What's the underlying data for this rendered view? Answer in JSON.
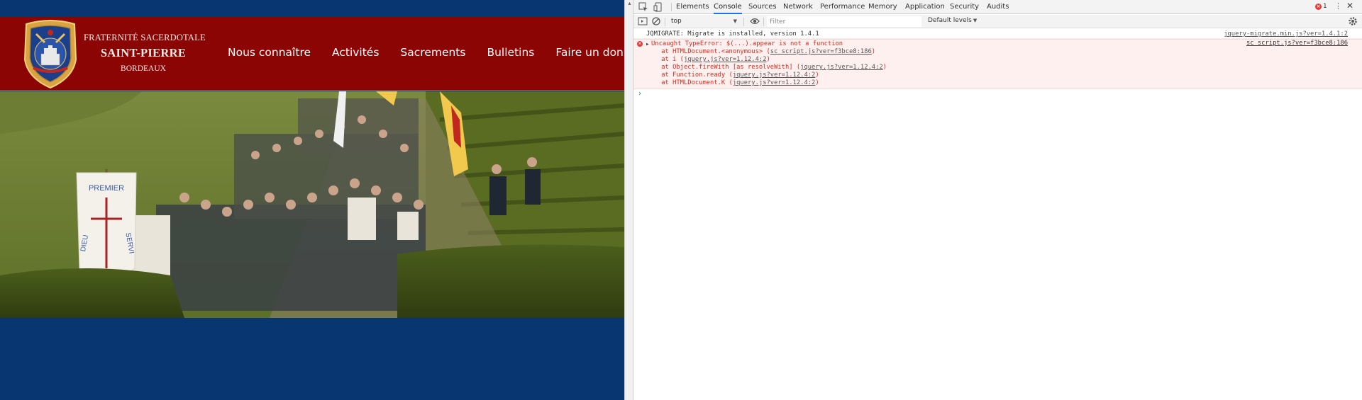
{
  "site": {
    "brand": {
      "line1": "FRATERNITÉ SACERDOTALE",
      "line2": "SAINT-PIERRE",
      "line3": "BORDEAUX"
    },
    "nav": [
      {
        "label": "Nous connaître"
      },
      {
        "label": "Activités"
      },
      {
        "label": "Sacrements"
      },
      {
        "label": "Bulletins"
      },
      {
        "label": "Faire un don"
      }
    ],
    "banner": {
      "words": [
        "PREMIER",
        "DIEU",
        "SERVI"
      ]
    },
    "colors": {
      "header": "#8c0505",
      "page": "#083671"
    }
  },
  "devtools": {
    "tabs": [
      {
        "label": "Elements"
      },
      {
        "label": "Console",
        "active": true
      },
      {
        "label": "Sources"
      },
      {
        "label": "Network"
      },
      {
        "label": "Performance"
      },
      {
        "label": "Memory"
      },
      {
        "label": "Application"
      },
      {
        "label": "Security"
      },
      {
        "label": "Audits"
      }
    ],
    "error_count": "1",
    "context": "top",
    "filter_placeholder": "Filter",
    "levels": "Default levels",
    "console": {
      "log": {
        "text": "JQMIGRATE: Migrate is installed, version 1.4.1",
        "source": "jquery-migrate.min.js?ver=1.4.1:2"
      },
      "error": {
        "message": "Uncaught TypeError: $(...).appear is not a function",
        "source": "sc_script.js?ver=f3bce8:186",
        "stack": [
          {
            "prefix": "at HTMLDocument.<anonymous> (",
            "link": "sc_script.js?ver=f3bce8:186",
            "suffix": ")"
          },
          {
            "prefix": "at i (",
            "link": "jquery.js?ver=1.12.4:2",
            "suffix": ")"
          },
          {
            "prefix": "at Object.fireWith [as resolveWith] (",
            "link": "jquery.js?ver=1.12.4:2",
            "suffix": ")"
          },
          {
            "prefix": "at Function.ready (",
            "link": "jquery.js?ver=1.12.4:2",
            "suffix": ")"
          },
          {
            "prefix": "at HTMLDocument.K (",
            "link": "jquery.js?ver=1.12.4:2",
            "suffix": ")"
          }
        ]
      },
      "prompt": "›"
    }
  }
}
